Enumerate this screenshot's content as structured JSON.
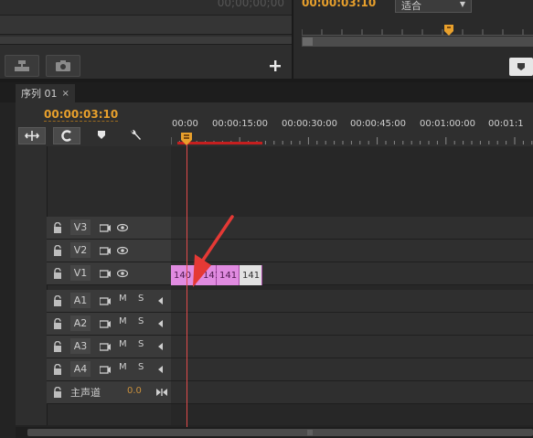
{
  "source_monitor": {
    "timecode": "00;00;00;00"
  },
  "program_monitor": {
    "timecode": "00:00:03:10",
    "fit_label": "适合"
  },
  "timeline": {
    "tab_label": "序列 01",
    "tab_close": "×",
    "timecode": "00:00:03:10",
    "ruler_labels": [
      "00:00",
      "00:00:15:00",
      "00:00:30:00",
      "00:00:45:00",
      "00:01:00:00",
      "00:01:1"
    ],
    "video_tracks": [
      "V3",
      "V2",
      "V1"
    ],
    "audio_tracks": [
      "A1",
      "A2",
      "A3",
      "A4"
    ],
    "mute_label": "M",
    "solo_label": "S",
    "master_track": {
      "name": "主声道",
      "value": "0.0"
    },
    "clips": [
      "140",
      "141",
      "141",
      "141"
    ]
  },
  "colors": {
    "timecode": "#e8a02c",
    "clip_pink": "#e08be0",
    "clip_gray": "#e2e2e2",
    "playhead": "#e24b4b",
    "annotation_arrow": "#e53935"
  }
}
